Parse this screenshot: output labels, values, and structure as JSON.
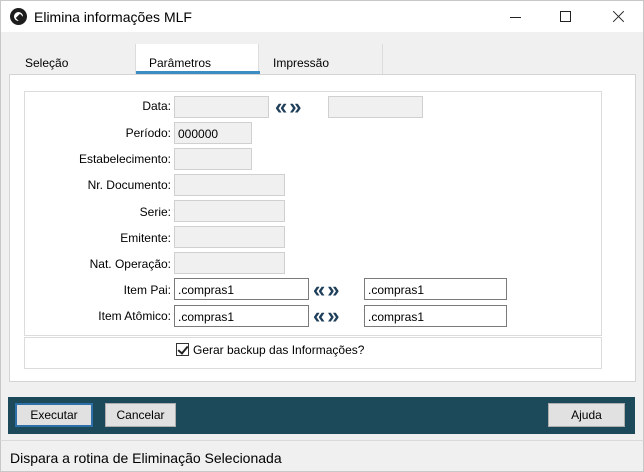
{
  "window": {
    "title": "Elimina informações MLF"
  },
  "tabs": [
    {
      "label": "Seleção"
    },
    {
      "label": "Parâmetros"
    },
    {
      "label": "Impressão"
    }
  ],
  "form": {
    "data_label": "Data:",
    "periodo_label": "Período:",
    "periodo_value": "000000",
    "estabelecimento_label": "Estabelecimento:",
    "nr_documento_label": "Nr. Documento:",
    "serie_label": "Serie:",
    "emitente_label": "Emitente:",
    "nat_operacao_label": "Nat. Operação:",
    "item_pai_label": "Item Pai:",
    "item_pai_from": ".compras1",
    "item_pai_to": ".compras1",
    "item_atomico_label": "Item Atômico:",
    "item_atomico_from": ".compras1",
    "item_atomico_to": ".compras1",
    "range_arrows": "«»",
    "backup_label": "Gerar backup das Informações?",
    "backup_checked": true
  },
  "buttons": {
    "executar": "Executar",
    "cancelar": "Cancelar",
    "ajuda": "Ajuda"
  },
  "status": {
    "text": "Dispara a rotina de Eliminação Selecionada"
  },
  "colors": {
    "button_bar": "#1c4a5a",
    "tab_underline": "#3c8dc4",
    "arrows": "#1f3f5a"
  }
}
